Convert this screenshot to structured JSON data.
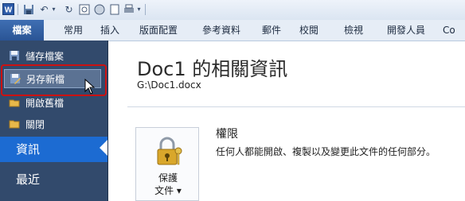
{
  "ribbon": {
    "tabs": [
      "檔案",
      "常用",
      "插入",
      "版面配置",
      "參考資料",
      "郵件",
      "校閱",
      "檢視",
      "開發人員",
      "Co"
    ]
  },
  "backstage": {
    "commands": [
      "儲存檔案",
      "另存新檔",
      "開啟舊檔",
      "關閉"
    ],
    "nav": [
      "資訊",
      "最近"
    ]
  },
  "info": {
    "title": "Doc1 的相關資訊",
    "path": "G:\\Doc1.docx",
    "permissions": {
      "title": "權限",
      "description": "任何人都能開啟、複製以及變更此文件的任何部分。",
      "button_line1": "保護",
      "button_line2": "文件 ▾"
    }
  },
  "colors": {
    "accent": "#1c6bd2",
    "backstage_panel": "#324a6c",
    "highlight": "#cc1111"
  }
}
